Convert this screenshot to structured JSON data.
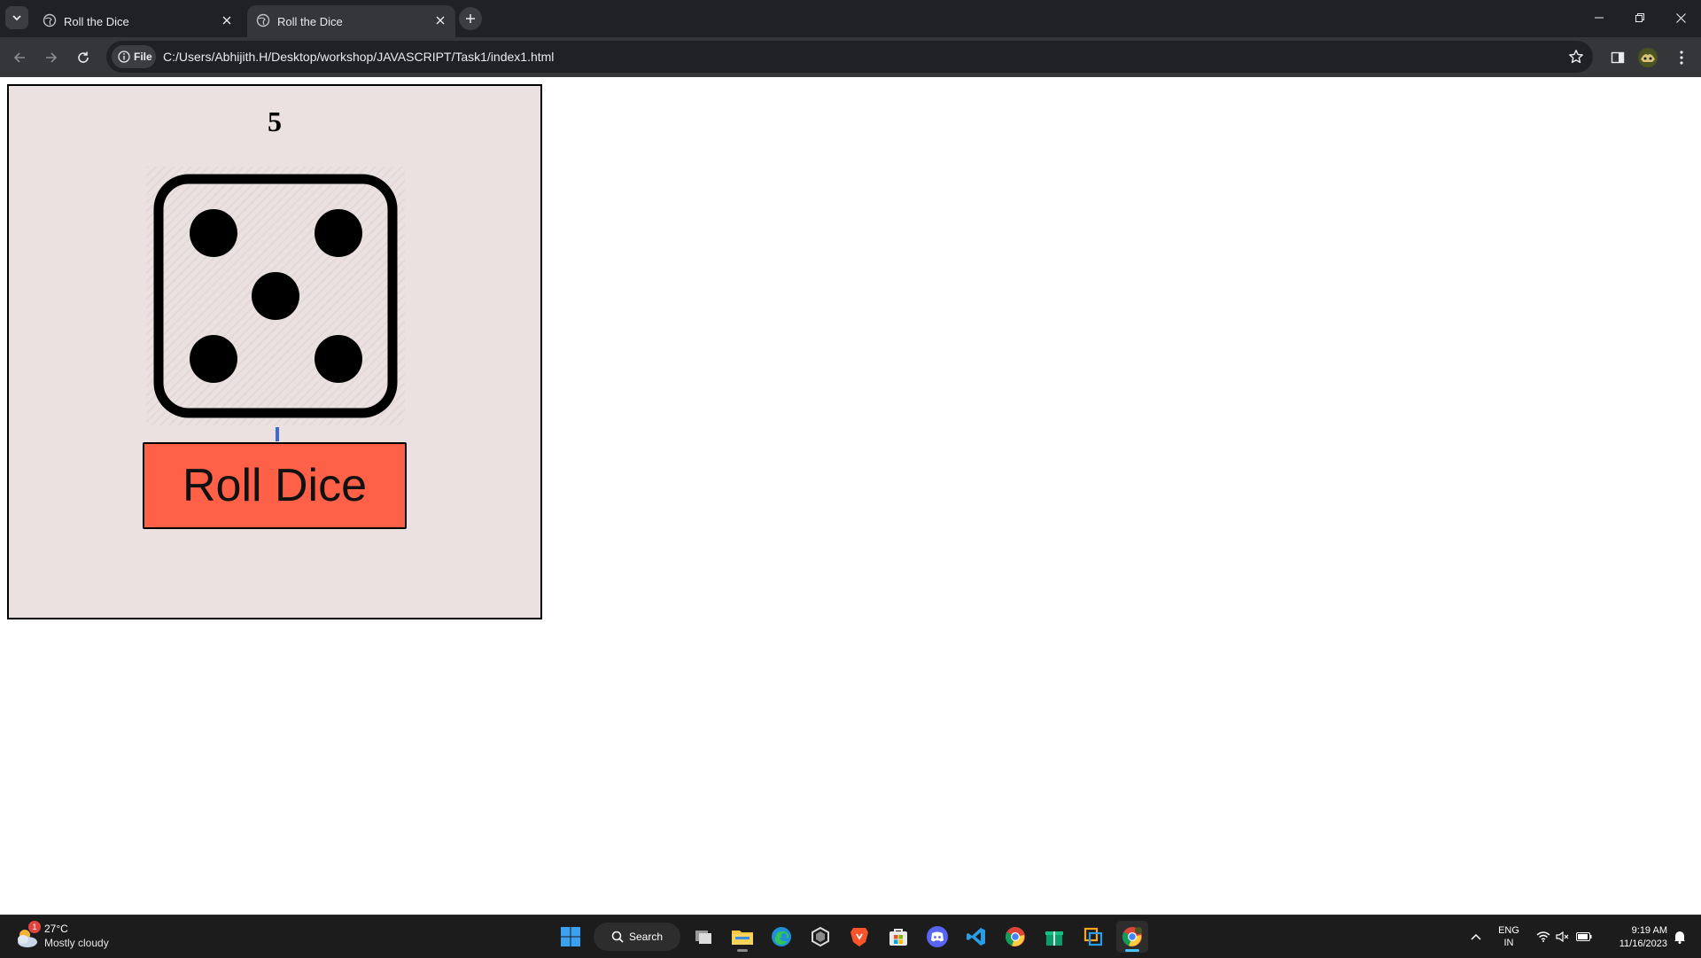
{
  "browser": {
    "tabs": [
      {
        "label": "Roll the Dice",
        "active": false
      },
      {
        "label": "Roll the Dice",
        "active": true
      }
    ],
    "address": {
      "chip_label": "File",
      "url": "C:/Users/Abhijith.H/Desktop/workshop/JAVASCRIPT/Task1/index1.html"
    }
  },
  "page": {
    "result": "5",
    "dice_value": 5,
    "button_label": "Roll Dice",
    "colors": {
      "panel_bg": "#ebe1e0",
      "button_bg": "#fe6148"
    }
  },
  "taskbar": {
    "weather": {
      "temp": "27°C",
      "condition": "Mostly cloudy",
      "badge": "1"
    },
    "search_label": "Search",
    "apps": [
      "task-view",
      "file-explorer",
      "edge",
      "unity",
      "brave",
      "microsoft-store",
      "discord",
      "vscode",
      "chrome",
      "gift",
      "overlay-app",
      "chrome-active"
    ],
    "language": {
      "line1": "ENG",
      "line2": "IN"
    },
    "clock": {
      "time": "9:19 AM",
      "date": "11/16/2023"
    }
  }
}
